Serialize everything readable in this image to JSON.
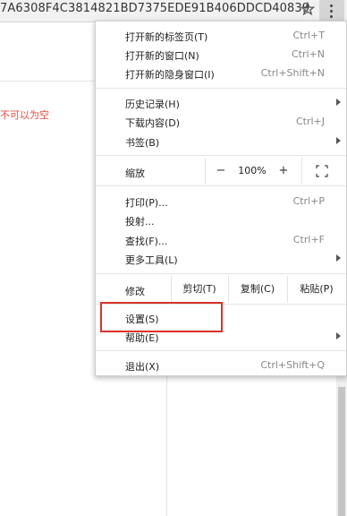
{
  "address_bar": {
    "url": "7A6308F4C3814821BD7375EDE91B406DDCD40839"
  },
  "background": {
    "error_text": "不可以为空"
  },
  "menu": {
    "new_tab": {
      "label": "打开新的标签页(T)",
      "shortcut": "Ctrl+T"
    },
    "new_window": {
      "label": "打开新的窗口(N)",
      "shortcut": "Ctrl+N"
    },
    "incognito": {
      "label": "打开新的隐身窗口(I)",
      "shortcut": "Ctrl+Shift+N"
    },
    "history": {
      "label": "历史记录(H)"
    },
    "downloads": {
      "label": "下载内容(D)",
      "shortcut": "Ctrl+J"
    },
    "bookmarks": {
      "label": "书签(B)"
    },
    "zoom": {
      "label": "缩放",
      "minus": "−",
      "value": "100%",
      "plus": "+"
    },
    "print": {
      "label": "打印(P)...",
      "shortcut": "Ctrl+P"
    },
    "cast": {
      "label": "投射..."
    },
    "find": {
      "label": "查找(F)...",
      "shortcut": "Ctrl+F"
    },
    "more_tools": {
      "label": "更多工具(L)"
    },
    "edit": {
      "label": "修改",
      "cut": "剪切(T)",
      "copy": "复制(C)",
      "paste": "粘贴(P)"
    },
    "settings": {
      "label": "设置(S)"
    },
    "help": {
      "label": "帮助(E)"
    },
    "exit": {
      "label": "退出(X)",
      "shortcut": "Ctrl+Shift+Q"
    }
  },
  "colors": {
    "highlight_border": "#d9332b",
    "error_text": "#e84c3d"
  }
}
